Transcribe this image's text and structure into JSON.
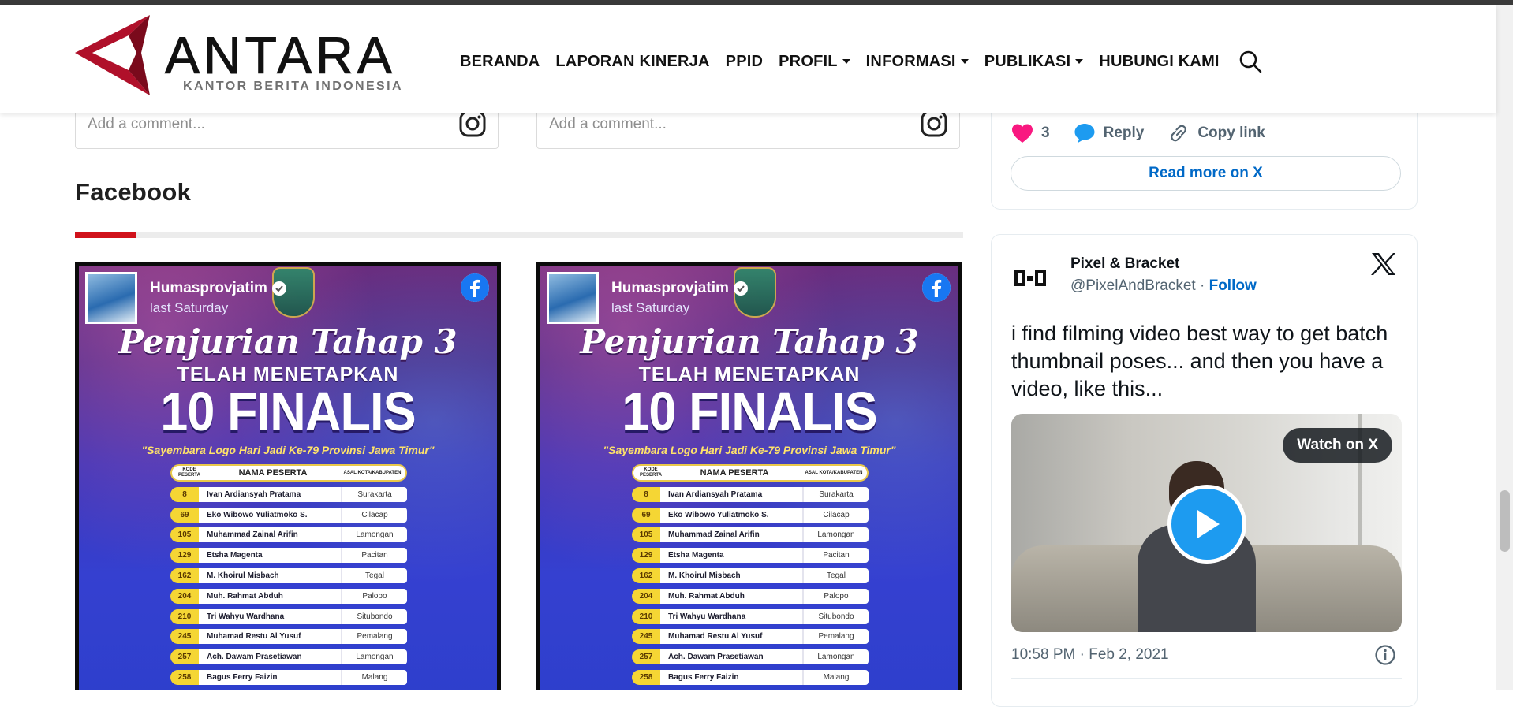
{
  "header": {
    "logo_text": "ANTARA",
    "logo_subtitle": "KANTOR BERITA INDONESIA",
    "nav": [
      {
        "label": "BERANDA",
        "dropdown": false
      },
      {
        "label": "LAPORAN KINERJA",
        "dropdown": false
      },
      {
        "label": "PPID",
        "dropdown": false
      },
      {
        "label": "PROFIL",
        "dropdown": true
      },
      {
        "label": "INFORMASI",
        "dropdown": true
      },
      {
        "label": "PUBLIKASI",
        "dropdown": true
      },
      {
        "label": "HUBUNGI KAMI",
        "dropdown": false
      }
    ],
    "search_icon": "search-icon"
  },
  "instagram": {
    "comment_placeholder_1": "Add a comment...",
    "comment_placeholder_2": "Add a comment..."
  },
  "facebook_section": {
    "title": "Facebook",
    "accent_color": "#d0121b",
    "posts": [
      {
        "author": "Humasprovjatim",
        "time": "last Saturday",
        "poster": {
          "title1": "Penjurian Tahap 3",
          "title2": "TELAH MENETAPKAN",
          "title3": "10 FINALIS",
          "quote": "\"Sayembara Logo Hari Jadi Ke-79 Provinsi Jawa Timur\"",
          "head_code": "KODE PESERTA",
          "head_name": "NAMA PESERTA",
          "head_city": "ASAL KOTA/KABUPATEN",
          "rows": [
            {
              "code": "8",
              "name": "Ivan Ardiansyah Pratama",
              "city": "Surakarta"
            },
            {
              "code": "69",
              "name": "Eko Wibowo Yuliatmoko S.",
              "city": "Cilacap"
            },
            {
              "code": "105",
              "name": "Muhammad Zainal Arifin",
              "city": "Lamongan"
            },
            {
              "code": "129",
              "name": "Etsha Magenta",
              "city": "Pacitan"
            },
            {
              "code": "162",
              "name": "M. Khoirul Misbach",
              "city": "Tegal"
            },
            {
              "code": "204",
              "name": "Muh. Rahmat Abduh",
              "city": "Palopo"
            },
            {
              "code": "210",
              "name": "Tri Wahyu Wardhana",
              "city": "Situbondo"
            },
            {
              "code": "245",
              "name": "Muhamad Restu Al Yusuf",
              "city": "Pemalang"
            },
            {
              "code": "257",
              "name": "Ach. Dawam Prasetiawan",
              "city": "Lamongan"
            },
            {
              "code": "258",
              "name": "Bagus Ferry Faizin",
              "city": "Malang"
            }
          ]
        }
      },
      {
        "author": "Humasprovjatim",
        "time": "last Saturday",
        "poster": {
          "title1": "Penjurian Tahap 3",
          "title2": "TELAH MENETAPKAN",
          "title3": "10 FINALIS",
          "quote": "\"Sayembara Logo Hari Jadi Ke-79 Provinsi Jawa Timur\"",
          "head_code": "KODE PESERTA",
          "head_name": "NAMA PESERTA",
          "head_city": "ASAL KOTA/KABUPATEN",
          "rows": [
            {
              "code": "8",
              "name": "Ivan Ardiansyah Pratama",
              "city": "Surakarta"
            },
            {
              "code": "69",
              "name": "Eko Wibowo Yuliatmoko S.",
              "city": "Cilacap"
            },
            {
              "code": "105",
              "name": "Muhammad Zainal Arifin",
              "city": "Lamongan"
            },
            {
              "code": "129",
              "name": "Etsha Magenta",
              "city": "Pacitan"
            },
            {
              "code": "162",
              "name": "M. Khoirul Misbach",
              "city": "Tegal"
            },
            {
              "code": "204",
              "name": "Muh. Rahmat Abduh",
              "city": "Palopo"
            },
            {
              "code": "210",
              "name": "Tri Wahyu Wardhana",
              "city": "Situbondo"
            },
            {
              "code": "245",
              "name": "Muhamad Restu Al Yusuf",
              "city": "Pemalang"
            },
            {
              "code": "257",
              "name": "Ach. Dawam Prasetiawan",
              "city": "Lamongan"
            },
            {
              "code": "258",
              "name": "Bagus Ferry Faizin",
              "city": "Malang"
            }
          ]
        }
      }
    ]
  },
  "tweet_top": {
    "like_count": "3",
    "reply_label": "Reply",
    "copy_link_label": "Copy link",
    "read_more_label": "Read more on X"
  },
  "tweet": {
    "name": "Pixel & Bracket",
    "handle": "@PixelAndBracket",
    "separator": " · ",
    "follow_label": "Follow",
    "text": "i find filming video best way to get batch thumbnail poses... and then you have a video, like this...",
    "watch_label": "Watch on X",
    "date": "10:58 PM · Feb 2, 2021"
  },
  "colors": {
    "brand_red": "#b0102a",
    "x_link_blue": "#0069c7",
    "like_pink": "#f91880",
    "play_blue": "#1d9bf0"
  }
}
